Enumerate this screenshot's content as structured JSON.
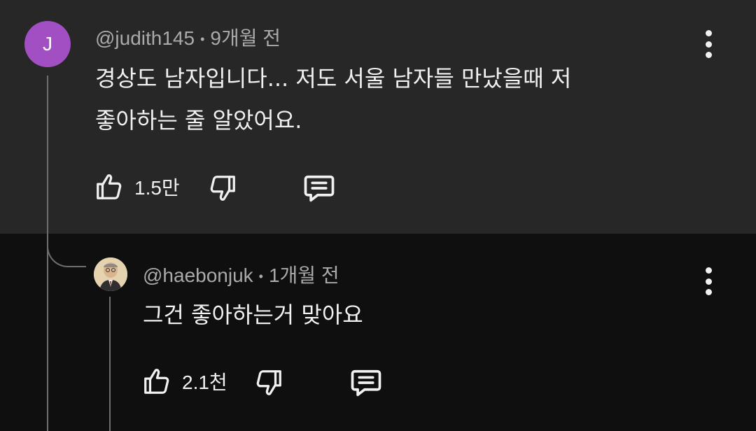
{
  "comments": [
    {
      "avatar_initial": "J",
      "avatar_color": "#a34fc4",
      "username": "@judith145",
      "separator": "•",
      "time": "9개월 전",
      "lines": [
        "경상도 남자입니다... 저도 서울 남자들 만났을때 저",
        "좋아하는 줄 알았어요."
      ],
      "likes": "1.5만"
    },
    {
      "avatar_icon": "person-avatar",
      "username": "@haebonjuk",
      "separator": "•",
      "time": "1개월 전",
      "lines": [
        "그건 좋아하는거 맞아요"
      ],
      "likes": "2.1천"
    }
  ],
  "colors": {
    "top_background": "#272727",
    "reply_background": "#0f0f0f",
    "muted_text": "#aaaaaa",
    "text": "#f1f1f1"
  },
  "icons": [
    "thumbs-up-icon",
    "thumbs-down-icon",
    "reply-icon",
    "more-vert-icon"
  ]
}
